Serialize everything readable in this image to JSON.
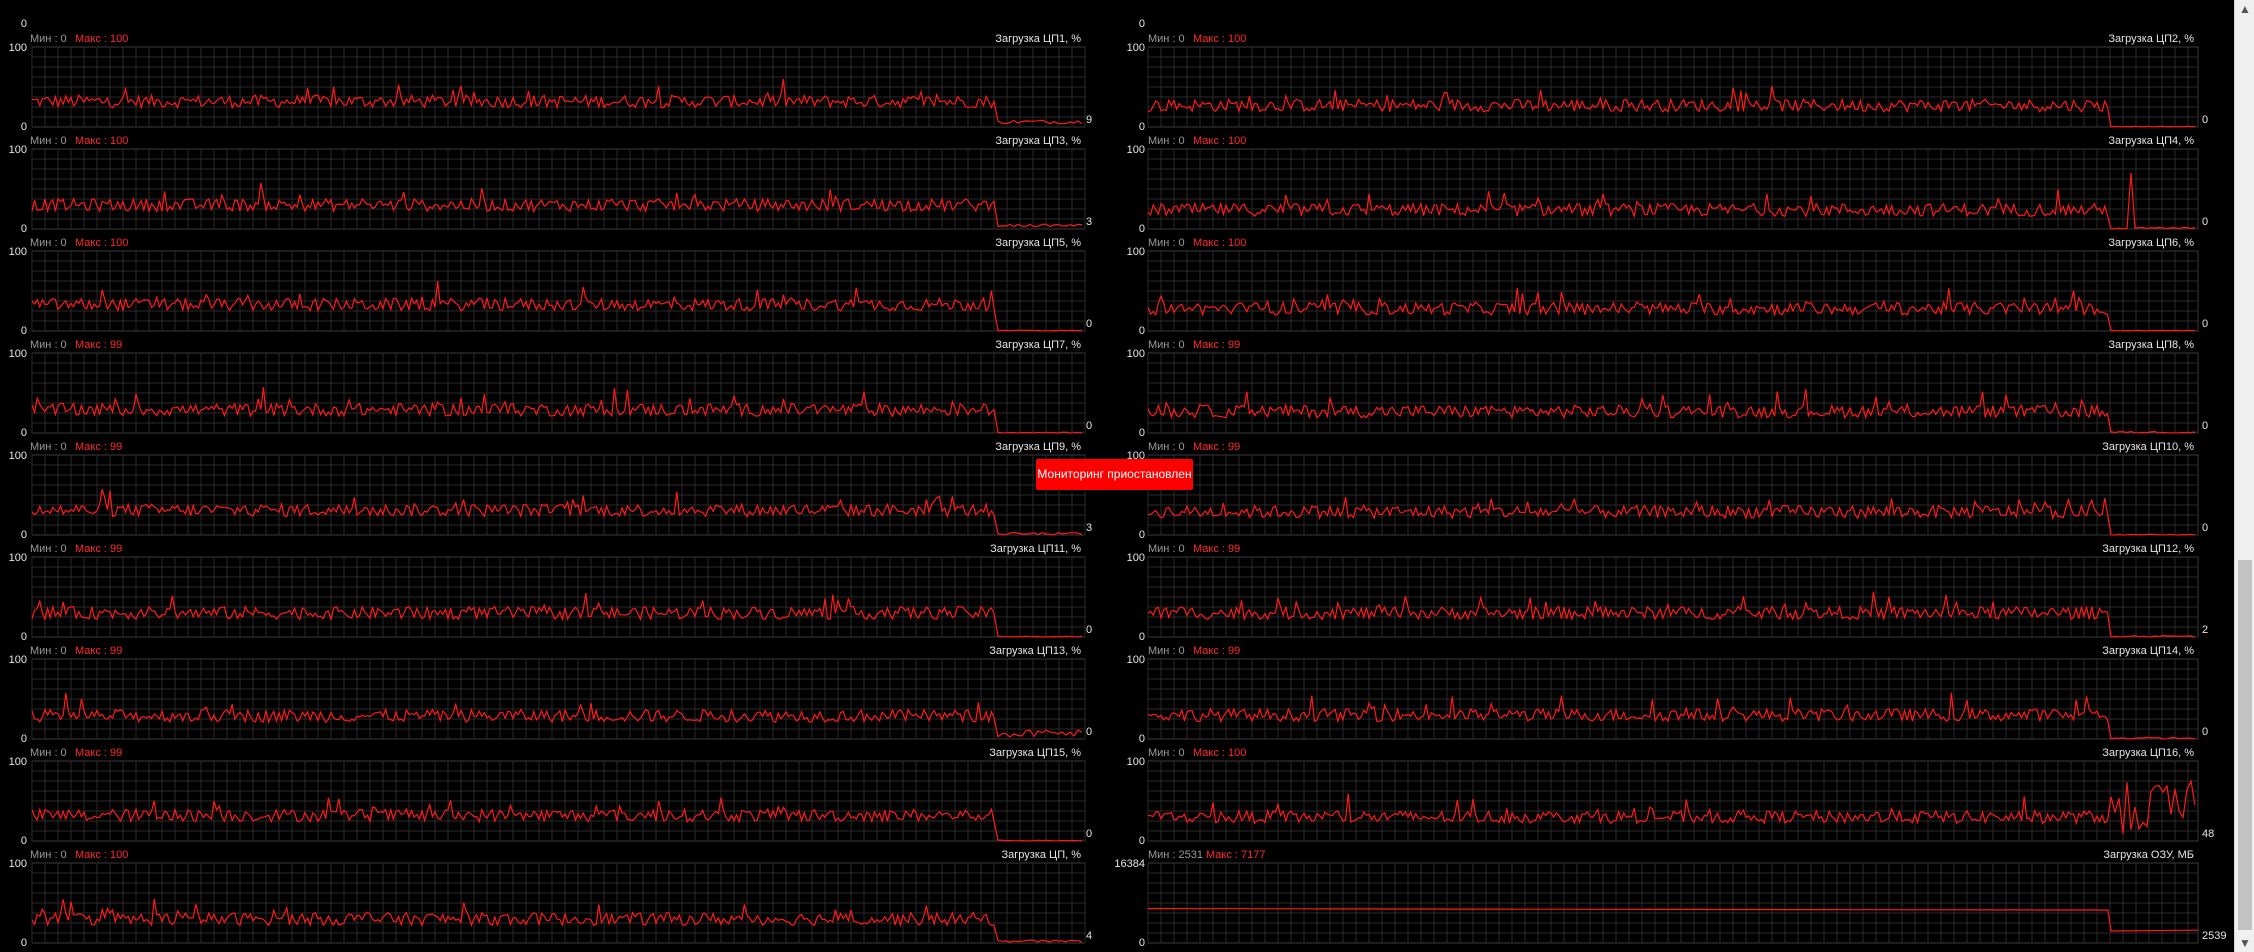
{
  "window": {
    "status_message": "Мониторинг приостановлен"
  },
  "colors": {
    "series": "#ff1a1a",
    "grid": "#2a2a2a",
    "background": "#000000",
    "max_text": "#ff2a2a",
    "min_text": "#9a9a9a"
  },
  "charts": [
    {
      "title": "Загрузка ЦП1, %",
      "min_label": "Мин : 0",
      "max_label": "Макс : 100",
      "y_top": "100",
      "y_bottom": "0",
      "current": "9",
      "top_label": "0",
      "level": 32,
      "end": [
        4,
        9
      ]
    },
    {
      "title": "Загрузка ЦП2, %",
      "min_label": "Мин : 0",
      "max_label": "Макс : 100",
      "y_top": "100",
      "y_bottom": "0",
      "current": "0",
      "top_label": "0",
      "level": 27,
      "end": [
        0,
        1
      ]
    },
    {
      "title": "Загрузка ЦП3, %",
      "min_label": "Мин : 0",
      "max_label": "Макс : 100",
      "y_top": "100",
      "y_bottom": "0",
      "current": "3",
      "top_label": "",
      "level": 30,
      "end": [
        3,
        6
      ]
    },
    {
      "title": "Загрузка ЦП4, %",
      "min_label": "Мин : 0",
      "max_label": "Макс : 100",
      "y_top": "100",
      "y_bottom": "0",
      "current": "0",
      "top_label": "",
      "level": 24,
      "end": [
        0,
        2
      ],
      "spike": 70
    },
    {
      "title": "Загрузка ЦП5, %",
      "min_label": "Мин : 0",
      "max_label": "Макс : 100",
      "y_top": "100",
      "y_bottom": "0",
      "current": "0",
      "top_label": "",
      "level": 33,
      "end": [
        0,
        1
      ]
    },
    {
      "title": "Загрузка ЦП6, %",
      "min_label": "Мин : 0",
      "max_label": "Макс : 100",
      "y_top": "100",
      "y_bottom": "0",
      "current": "0",
      "top_label": "",
      "level": 28,
      "end": [
        0,
        1
      ]
    },
    {
      "title": "Загрузка ЦП7, %",
      "min_label": "Мин : 0",
      "max_label": "Макс : 99",
      "y_top": "100",
      "y_bottom": "0",
      "current": "0",
      "top_label": "",
      "level": 29,
      "end": [
        0,
        1
      ]
    },
    {
      "title": "Загрузка ЦП8, %",
      "min_label": "Мин : 0",
      "max_label": "Макс : 99",
      "y_top": "100",
      "y_bottom": "0",
      "current": "0",
      "top_label": "",
      "level": 27,
      "end": [
        0,
        2
      ]
    },
    {
      "title": "Загрузка ЦП9, %",
      "min_label": "Мин : 0",
      "max_label": "Макс : 99",
      "y_top": "100",
      "y_bottom": "0",
      "current": "3",
      "top_label": "",
      "level": 31,
      "end": [
        0,
        3
      ]
    },
    {
      "title": "Загрузка ЦП10, %",
      "min_label": "Мин : 0",
      "max_label": "Макс : 99",
      "y_top": "100",
      "y_bottom": "0",
      "current": "0",
      "top_label": "",
      "level": 29,
      "end": [
        0,
        1
      ]
    },
    {
      "title": "Загрузка ЦП11, %",
      "min_label": "Мин : 0",
      "max_label": "Макс : 99",
      "y_top": "100",
      "y_bottom": "0",
      "current": "0",
      "top_label": "",
      "level": 30,
      "end": [
        0,
        1
      ]
    },
    {
      "title": "Загрузка ЦП12, %",
      "min_label": "Мин : 0",
      "max_label": "Макс : 99",
      "y_top": "100",
      "y_bottom": "0",
      "current": "2",
      "top_label": "",
      "level": 30,
      "end": [
        0,
        2
      ]
    },
    {
      "title": "Загрузка ЦП13, %",
      "min_label": "Мин : 0",
      "max_label": "Макс : 99",
      "y_top": "100",
      "y_bottom": "0",
      "current": "0",
      "top_label": "",
      "level": 29,
      "end": [
        2,
        12
      ]
    },
    {
      "title": "Загрузка ЦП14, %",
      "min_label": "Мин : 0",
      "max_label": "Макс : 99",
      "y_top": "100",
      "y_bottom": "0",
      "current": "0",
      "top_label": "",
      "level": 30,
      "end": [
        0,
        2
      ]
    },
    {
      "title": "Загрузка ЦП15, %",
      "min_label": "Мин : 0",
      "max_label": "Макс : 99",
      "y_top": "100",
      "y_bottom": "0",
      "current": "0",
      "top_label": "",
      "level": 32,
      "end": [
        0,
        1
      ]
    },
    {
      "title": "Загрузка ЦП16, %",
      "min_label": "Мин : 0",
      "max_label": "Макс : 100",
      "y_top": "100",
      "y_bottom": "0",
      "current": "48",
      "top_label": "",
      "level": 30,
      "end": [
        5,
        75
      ]
    },
    {
      "title": "Загрузка ЦП, %",
      "min_label": "Мин : 0",
      "max_label": "Макс : 100",
      "y_top": "100",
      "y_bottom": "0",
      "current": "4",
      "top_label": "",
      "level": 30,
      "end": [
        1,
        4
      ]
    },
    {
      "title": "Загрузка ОЗУ, МБ",
      "min_label": "Мин : 2531",
      "max_label": "Макс : 7177",
      "y_top": "16384",
      "y_bottom": "0",
      "current": "2539",
      "top_label": "",
      "level": 43,
      "end": [
        15,
        16
      ],
      "flat": true
    }
  ]
}
